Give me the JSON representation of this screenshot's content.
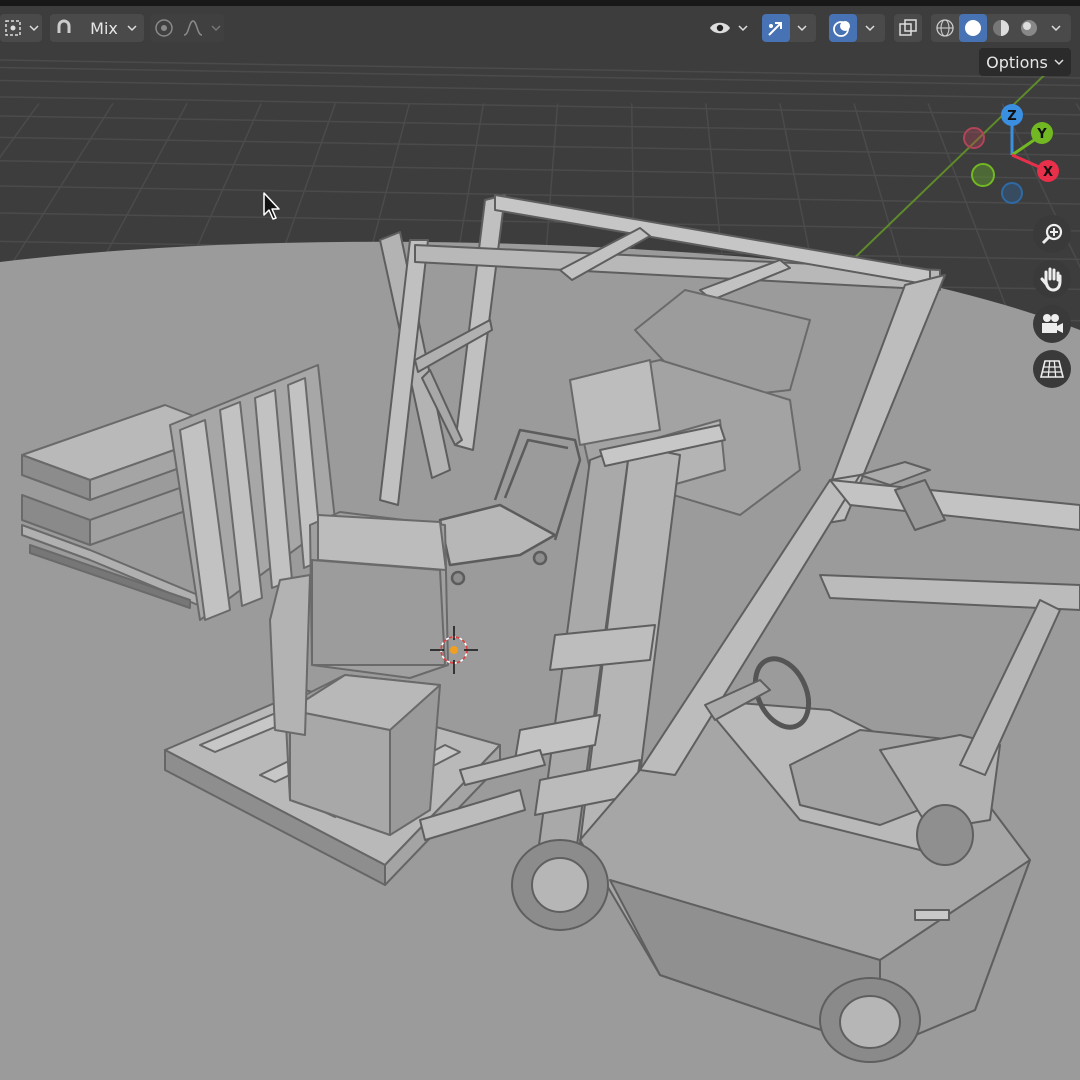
{
  "header": {
    "blend_mode_label": "Mix",
    "options_label": "Options"
  },
  "gizmo": {
    "x_label": "X",
    "y_label": "Y",
    "z_label": "Z",
    "colors": {
      "x": "#e8304a",
      "y": "#72b822",
      "z": "#3b8fe0",
      "neg_x": "#b14459",
      "neg_y": "#5e9630",
      "neg_z": "#2e6aa5"
    }
  },
  "icons": {
    "transform_pivot": "pivot-icon",
    "snap": "snap-magnet-icon",
    "proportional": "proportional-edit-icon",
    "falloff": "falloff-curve-icon",
    "visibility": "eye-visibility-icon",
    "gizmo_toggle": "gizmo-arrow-icon",
    "overlay": "overlay-icon",
    "xray": "xray-icon",
    "shading_wire": "wireframe-shading-icon",
    "shading_solid": "solid-shading-icon",
    "shading_material": "material-shading-icon",
    "shading_rendered": "rendered-shading-icon",
    "zoom": "zoom-icon",
    "pan": "hand-pan-icon",
    "camera": "camera-icon",
    "ortho": "grid-perspective-icon"
  },
  "theme": {
    "accent": "#4772b3",
    "grid_line": "#4a4a4a",
    "floor": "#9a9a9a"
  }
}
